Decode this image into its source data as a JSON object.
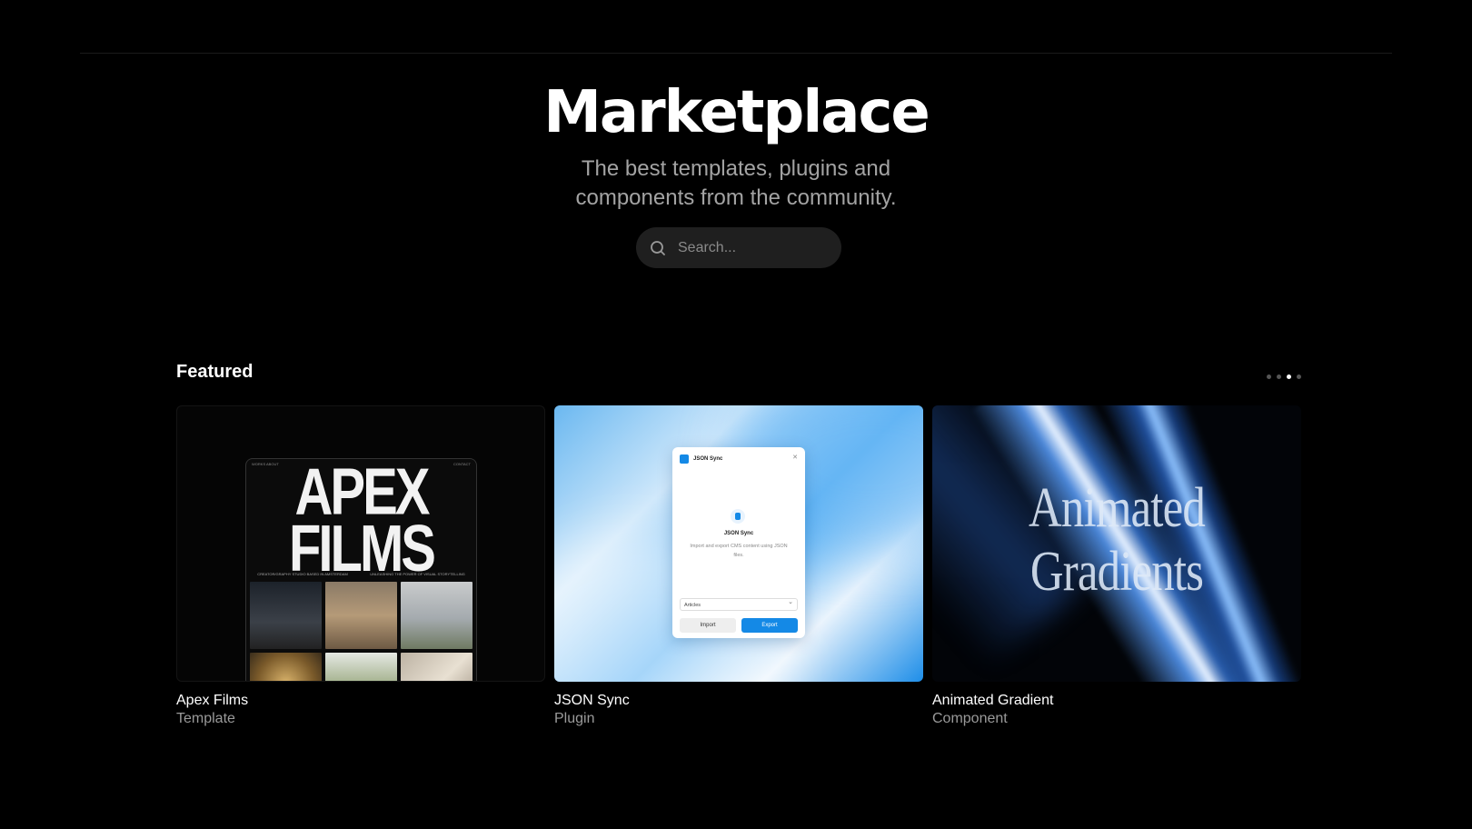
{
  "hero": {
    "title": "Marketplace",
    "subtitle": "The best templates, plugins and components from the community."
  },
  "search": {
    "placeholder": "Search...",
    "icon": "search-icon"
  },
  "featured": {
    "heading": "Featured",
    "pagination": {
      "pages": 4,
      "active_index": 2
    },
    "cards": [
      {
        "name": "Apex Films",
        "type": "Template",
        "preview": {
          "logo": "APEX FILMS",
          "nav_left": "WORKS  ABOUT",
          "nav_right": "CONTACT",
          "tagline_left": "CREATOR/GRAPHY STUDIO BASED IN AMSTERDAM",
          "tagline_right": "UNLEASHING THE POWER OF VISUAL STORYTELLING"
        }
      },
      {
        "name": "JSON Sync",
        "type": "Plugin",
        "preview": {
          "window_title": "JSON Sync",
          "plugin_name": "JSON Sync",
          "description": "Import and export CMS content using JSON files.",
          "select_value": "Articles",
          "import_label": "Import",
          "export_label": "Export"
        }
      },
      {
        "name": "Animated Gradient",
        "type": "Component",
        "preview": {
          "text_line1": "Animated",
          "text_line2": "Gradients"
        }
      }
    ]
  },
  "colors": {
    "background": "#000000",
    "search_bg": "#1f1f1f",
    "subtitle": "#a3a3a3",
    "accent": "#1489e6"
  }
}
